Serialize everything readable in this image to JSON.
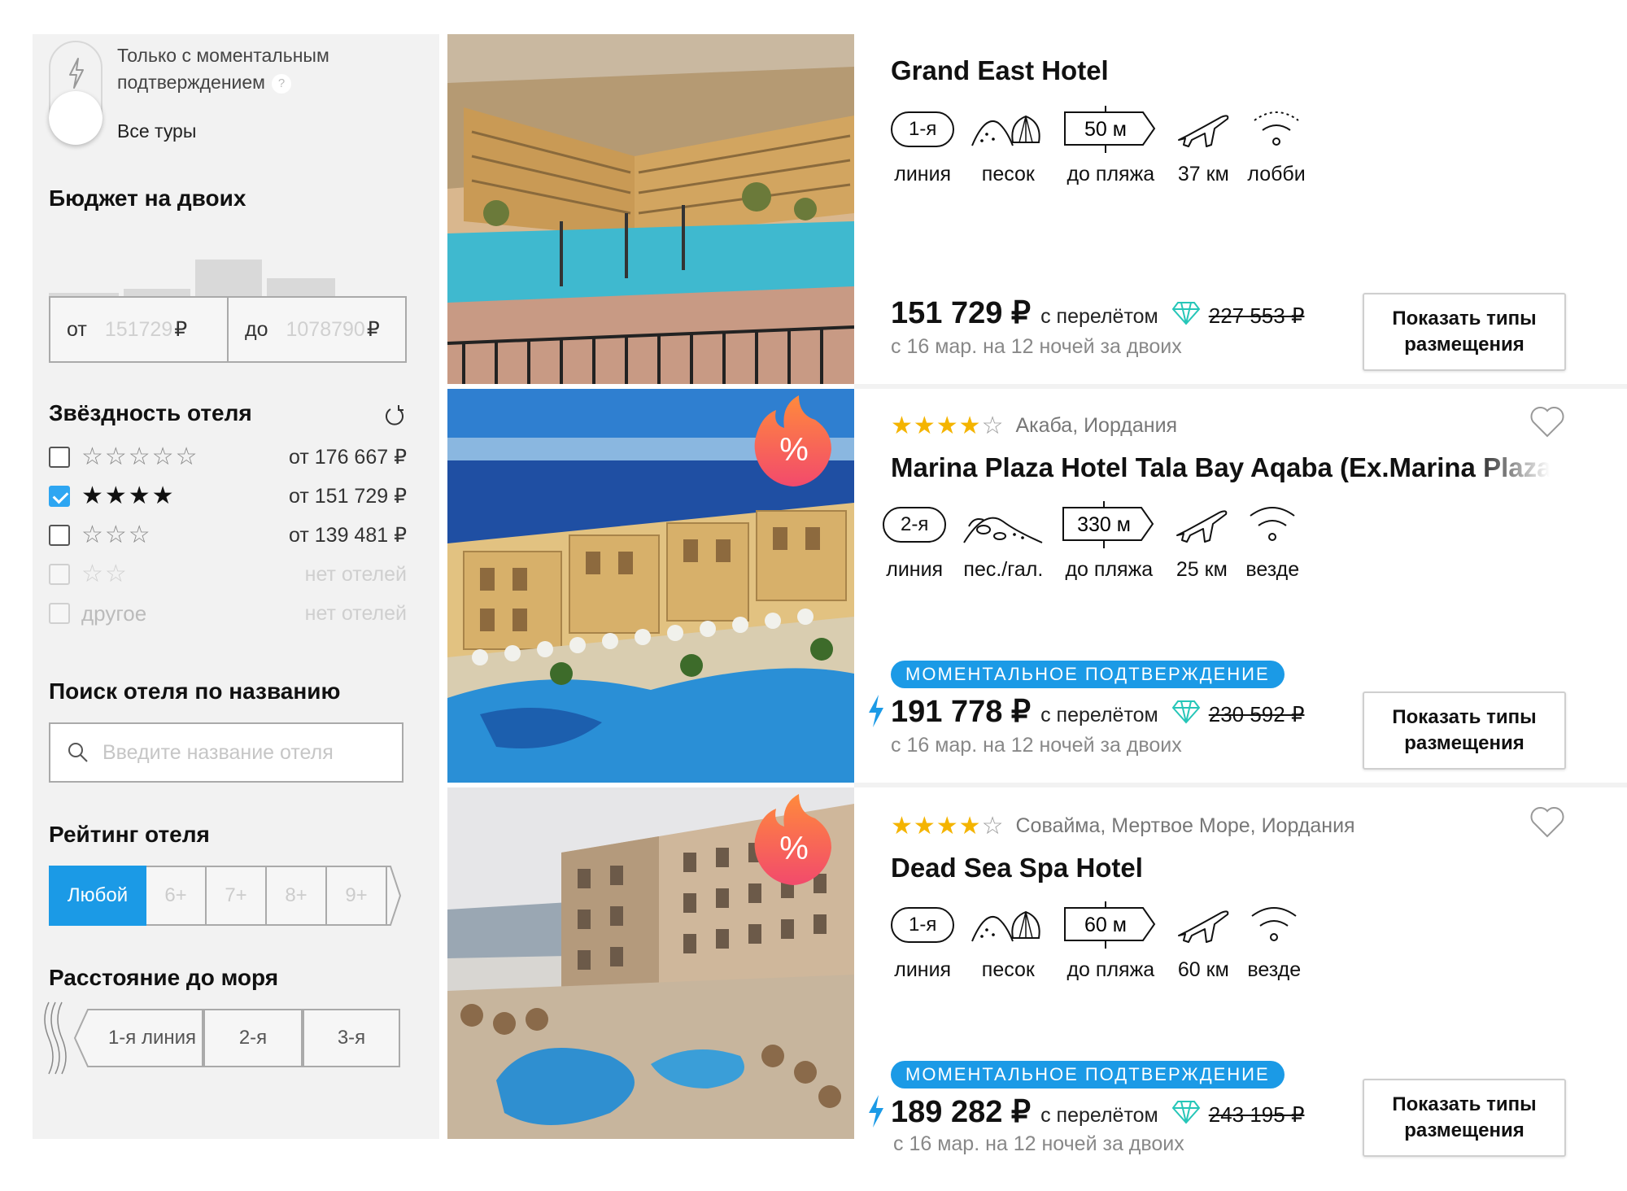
{
  "filters": {
    "instant_toggle": {
      "label_line1": "Только с моментальным",
      "label_line2": "подтверждением",
      "help": "?",
      "all_tours": "Все туры"
    },
    "budget": {
      "title": "Бюджет на двоих",
      "histogram_levels": [
        0.4,
        0.46,
        0.94,
        0.64,
        0.2
      ],
      "from_label": "от",
      "from_placeholder": "151729",
      "to_label": "до",
      "to_placeholder": "1078790",
      "currency": "₽"
    },
    "stars": {
      "title": "Звёздность отеля",
      "rows": [
        {
          "stars": 5,
          "checked": false,
          "price": "от 176 667 ₽"
        },
        {
          "stars": 4,
          "checked": true,
          "price": "от 151 729 ₽"
        },
        {
          "stars": 3,
          "checked": false,
          "price": "от 139 481 ₽"
        },
        {
          "stars": 2,
          "checked": false,
          "price": "нет отелей"
        },
        {
          "label": "другое",
          "checked": false,
          "price": "нет отелей"
        }
      ]
    },
    "hotel_search": {
      "title": "Поиск отеля по названию",
      "placeholder": "Введите название отеля"
    },
    "rating": {
      "title": "Рейтинг отеля",
      "options": [
        "Любой",
        "6+",
        "7+",
        "8+",
        "9+"
      ],
      "selected": "Любой"
    },
    "sea_distance": {
      "title": "Расстояние до моря",
      "options": [
        "1-я линия",
        "2-я",
        "3-я"
      ]
    }
  },
  "hotels": [
    {
      "name": "Grand East Hotel",
      "features": [
        {
          "value": "1-я",
          "caption": "линия",
          "icon": "line-pill-icon"
        },
        {
          "caption": "песок",
          "icon": "sand-beach-icon"
        },
        {
          "value": "50 м",
          "caption": "до пляжа",
          "icon": "distance-sign-icon"
        },
        {
          "caption": "37 км",
          "icon": "airplane-icon"
        },
        {
          "caption": "лобби",
          "icon": "wifi-lobby-icon"
        }
      ],
      "price": "151 729 ₽",
      "price_note": "с перелётом",
      "old_price": "227 553 ₽",
      "dates": "с 16 мар. на 12 ночей за двоих",
      "cta": [
        "Показать типы",
        "размещения"
      ]
    },
    {
      "stars": "★★★★",
      "stars_empty": "☆",
      "location": "Акаба, Иордания",
      "name": "Marina Plaza Hotel Tala Bay Aqaba (Ex.Marina Plaza",
      "hot_deal": true,
      "features": [
        {
          "value": "2-я",
          "caption": "линия",
          "icon": "line-pill-icon"
        },
        {
          "caption": "пес./гал.",
          "icon": "sand-pebble-icon"
        },
        {
          "value": "330 м",
          "caption": "до пляжа",
          "icon": "distance-sign-icon"
        },
        {
          "caption": "25 км",
          "icon": "airplane-icon"
        },
        {
          "caption": "везде",
          "icon": "wifi-icon"
        }
      ],
      "instant": "МОМЕНТАЛЬНОЕ ПОДТВЕРЖДЕНИЕ",
      "price": "191 778 ₽",
      "price_note": "с перелётом",
      "old_price": "230 592 ₽",
      "dates": "с 16 мар. на 12 ночей за двоих",
      "cta": [
        "Показать типы",
        "размещения"
      ]
    },
    {
      "stars": "★★★★",
      "stars_empty": "☆",
      "location": "Совайма, Мертвое Море, Иордания",
      "name": "Dead Sea Spa Hotel",
      "hot_deal": true,
      "features": [
        {
          "value": "1-я",
          "caption": "линия",
          "icon": "line-pill-icon"
        },
        {
          "caption": "песок",
          "icon": "sand-beach-icon"
        },
        {
          "value": "60 м",
          "caption": "до пляжа",
          "icon": "distance-sign-icon"
        },
        {
          "caption": "60 км",
          "icon": "airplane-icon"
        },
        {
          "caption": "везде",
          "icon": "wifi-icon"
        }
      ],
      "instant": "МОМЕНТАЛЬНОЕ ПОДТВЕРЖДЕНИЕ",
      "price": "189 282 ₽",
      "price_note": "с перелётом",
      "old_price": "243 195 ₽",
      "dates": "с 16 мар. на 12 ночей за двоих",
      "cta": [
        "Показать типы",
        "размещения"
      ]
    }
  ],
  "colors": {
    "accent": "#1b9ae6",
    "star": "#f4b400",
    "hot_deal": "#f24a6c",
    "gem": "#26c6b8"
  }
}
